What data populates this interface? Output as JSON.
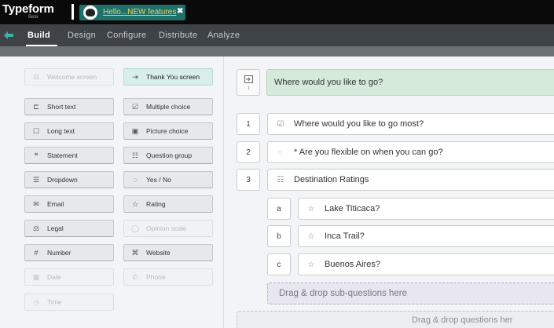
{
  "app": {
    "logo": "Typeform",
    "logo_badge": "Beta"
  },
  "form_tab": {
    "label": "Hello...NEW features",
    "close": "✖"
  },
  "nav": {
    "items": [
      {
        "label": "Build",
        "active": true
      },
      {
        "label": "Design"
      },
      {
        "label": "Configure"
      },
      {
        "label": "Distribute"
      },
      {
        "label": "Analyze"
      }
    ]
  },
  "question_types": [
    {
      "label": "Welcome screen",
      "icon": "welcome-icon",
      "disabled": true
    },
    {
      "label": "Thank You screen",
      "icon": "thank-you-icon",
      "highlight": true
    },
    {
      "label": "Short text",
      "icon": "short-text-icon"
    },
    {
      "label": "Multiple choice",
      "icon": "multiple-choice-icon"
    },
    {
      "label": "Long text",
      "icon": "long-text-icon"
    },
    {
      "label": "Picture choice",
      "icon": "picture-choice-icon"
    },
    {
      "label": "Statement",
      "icon": "statement-icon"
    },
    {
      "label": "Question group",
      "icon": "question-group-icon"
    },
    {
      "label": "Dropdown",
      "icon": "dropdown-icon"
    },
    {
      "label": "Yes / No",
      "icon": "yes-no-icon"
    },
    {
      "label": "Email",
      "icon": "email-icon"
    },
    {
      "label": "Rating",
      "icon": "rating-icon"
    },
    {
      "label": "Legal",
      "icon": "legal-icon"
    },
    {
      "label": "Opinion scale",
      "icon": "opinion-scale-icon",
      "disabled": true
    },
    {
      "label": "Number",
      "icon": "number-icon"
    },
    {
      "label": "Website",
      "icon": "website-icon"
    },
    {
      "label": "Date",
      "icon": "date-icon",
      "disabled": true
    },
    {
      "label": "Phone",
      "icon": "phone-icon",
      "disabled": true
    },
    {
      "label": "Time",
      "icon": "time-icon",
      "disabled": true
    }
  ],
  "welcome": {
    "text": "Where would you like to go?",
    "num_label": "1"
  },
  "questions": [
    {
      "num": "1",
      "text": "Where would you like to go most?",
      "icon": "multiple-choice-icon"
    },
    {
      "num": "2",
      "text": "* Are you flexible on when you can go?",
      "icon": "yes-no-icon"
    },
    {
      "num": "3",
      "text": "Destination Ratings",
      "icon": "question-group-icon"
    }
  ],
  "sub_questions": [
    {
      "letter": "a",
      "text": "Lake Titicaca?",
      "icon": "rating-icon"
    },
    {
      "letter": "b",
      "text": "Inca Trail?",
      "icon": "rating-icon"
    },
    {
      "letter": "c",
      "text": "Buenos Aires?",
      "icon": "rating-icon"
    }
  ],
  "drop_sub": "Drag & drop sub-questions here",
  "drop_main": "Drag & drop questions her"
}
